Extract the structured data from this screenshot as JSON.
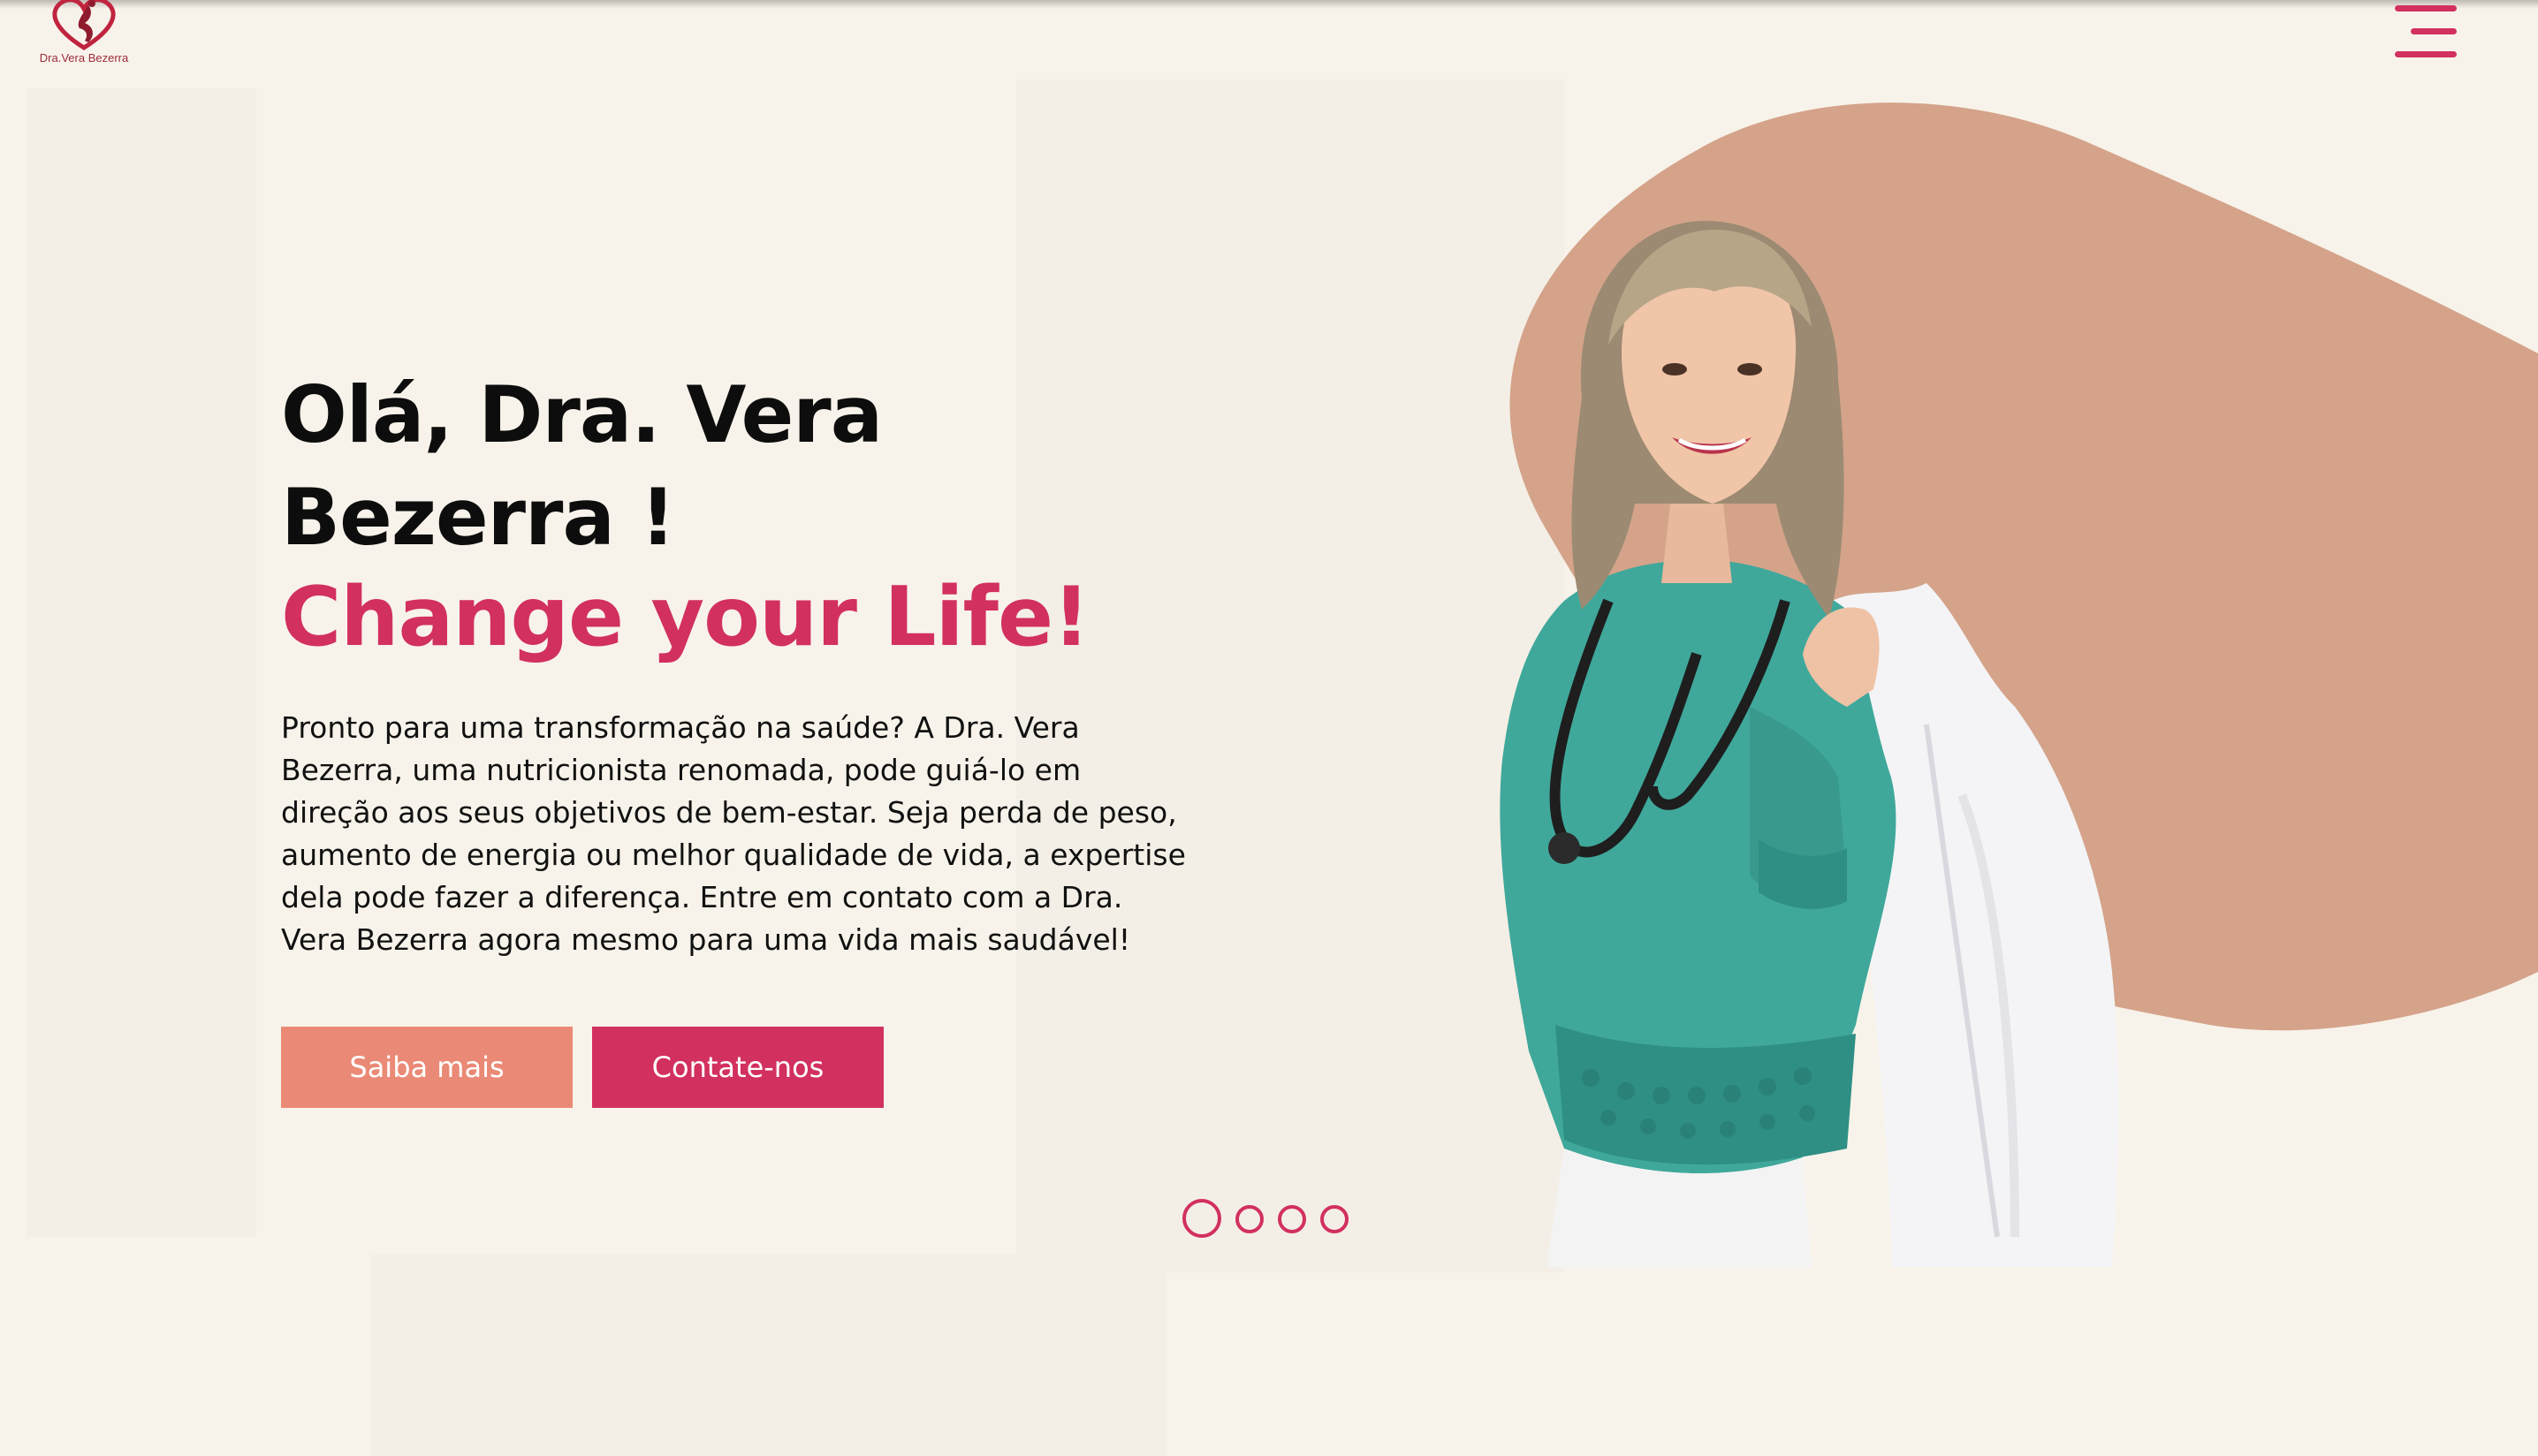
{
  "header": {
    "logo_text": "Dra.Vera Bezerra",
    "logo_icon": "heart-woman-logo",
    "menu_icon": "hamburger-menu-icon"
  },
  "hero": {
    "title": "Olá, Dra. Vera Bezerra !",
    "subtitle": "Change your Life!",
    "description": "Pronto para uma transformação na saúde? A Dra. Vera Bezerra, uma nutricionista renomada, pode guiá-lo em direção aos seus objetivos de bem-estar. Seja perda de peso, aumento de energia ou melhor qualidade de vida, a expertise dela pode fazer a diferença. Entre em contato com a Dra. Vera Bezerra agora mesmo para uma vida mais saudável!",
    "buttons": {
      "learn_more": "Saiba mais",
      "contact": "Contate-nos"
    }
  },
  "carousel": {
    "slide_count": 4,
    "active_index": 0
  },
  "colors": {
    "background": "#f8f3ea",
    "accent": "#d2305f",
    "secondary": "#ea8a76",
    "blob": "#d4a38a",
    "shirt": "#3fa89b"
  }
}
